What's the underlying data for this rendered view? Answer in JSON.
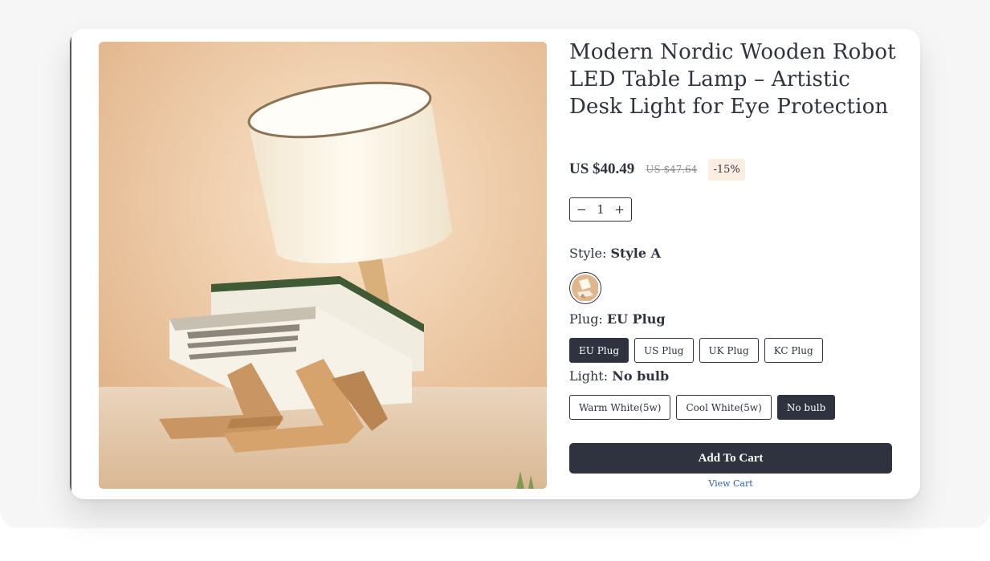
{
  "product": {
    "title": "Modern Nordic Wooden Robot LED Table Lamp – Artistic Desk Light for Eye Protection",
    "price": "US $40.49",
    "compare_price": "US $47.64",
    "discount": "-15%",
    "image_icon": "product-photo-lamp"
  },
  "quantity": {
    "minus": "−",
    "value": "1",
    "plus": "+"
  },
  "options": {
    "style": {
      "label": "Style:",
      "selected": "Style A"
    },
    "plug": {
      "label": "Plug:",
      "selected": "EU Plug",
      "choices": [
        "EU Plug",
        "US Plug",
        "UK Plug",
        "KC Plug"
      ]
    },
    "light": {
      "label": "Light:",
      "selected": "No bulb",
      "choices": [
        "Warm White(5w)",
        "Cool White(5w)",
        "No bulb"
      ]
    }
  },
  "actions": {
    "add_to_cart": "Add To Cart",
    "view_cart": "View Cart"
  },
  "colors": {
    "primary": "#2f3340",
    "discount_bg": "#fbeee1",
    "link": "#2c5fb0"
  }
}
